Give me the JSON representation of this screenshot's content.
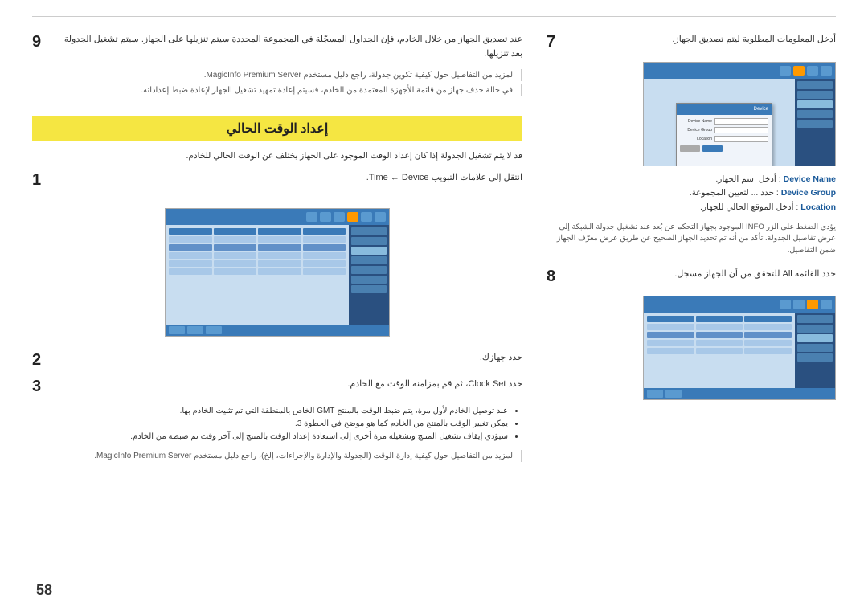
{
  "page": {
    "number": "58",
    "top_divider": true
  },
  "right_col": {
    "step7": {
      "number": "7",
      "intro_text": "أدخل المعلومات المطلوبة ليتم تصديق الجهاز.",
      "bullet_items": [
        {
          "label": "Device Name",
          "desc": "أدخل اسم الجهاز."
        },
        {
          "label": "Device Group",
          "desc": "حدد ... لتعيين المجموعة."
        },
        {
          "label": "Location",
          "desc": "أدخل الموقع الحالي للجهاز."
        }
      ],
      "note": "يؤدي الضغط على الزر INFO الموجود بجهاز التحكم عن بُعد عند تشغيل جدولة الشبكة إلى عرض تفاصيل الجدولة. تأكد من أنه تم تحديد الجهاز الصحيح عن طريق عرض معرّف الجهاز ضمن التفاصيل."
    },
    "step8": {
      "number": "8",
      "text": "حدد القائمة All للتحقق من أن الجهاز مسجل."
    }
  },
  "left_col": {
    "step9": {
      "number": "9",
      "text": "عند تصديق الجهاز من خلال الخادم، فإن الجداول المسجّلة في المجموعة المحددة سيتم تنزيلها على الجهاز. سيتم تشغيل الجدولة بعد تنزيلها.",
      "note1": "لمزيد من التفاصيل حول كيفية تكوين جدولة، راجع دليل مستخدم MagicInfo Premium Server.",
      "note2": "في حالة حذف جهاز من قائمة الأجهزة المعتمدة من الخادم، فسيتم إعادة تمهيد تشغيل الجهاز لإعادة ضبط إعداداته."
    },
    "section_heading": "إعداد الوقت الحالي",
    "section_desc": "قد لا يتم تشغيل الجدولة إذا كان إعداد الوقت الموجود على الجهاز يختلف عن الوقت الحالي للخادم.",
    "sub_step1": {
      "number": "1",
      "text": "انتقل إلى علامات التبويب Time ← Device."
    },
    "sub_step2": {
      "number": "2",
      "text": "حدد جهازك."
    },
    "sub_step3": {
      "number": "3",
      "text": "حدد Clock Set، ثم قم بمزامنة الوقت مع الخادم."
    },
    "bullet_items": [
      "عند توصيل الخادم لأول مرة، يتم ضبط الوقت بالمنتج GMT الخاص بالمنطقة التي تم تثبيت الخادم بها.",
      "يمكن تغيير الوقت بالمنتج من الخادم كما هو موضح في الخطوة 3.",
      "سيؤدي إيقاف تشغيل المنتج وتشغيله مرة أخرى إلى استعادة إعداد الوقت بالمنتج إلى آخر وقت تم ضبطه من الخادم."
    ],
    "note3": "لمزيد من التفاصيل حول كيفية إدارة الوقت (الجدولة والإدارة والإجراءات، إلخ)، راجع دليل مستخدم MagicInfo Premium Server."
  }
}
